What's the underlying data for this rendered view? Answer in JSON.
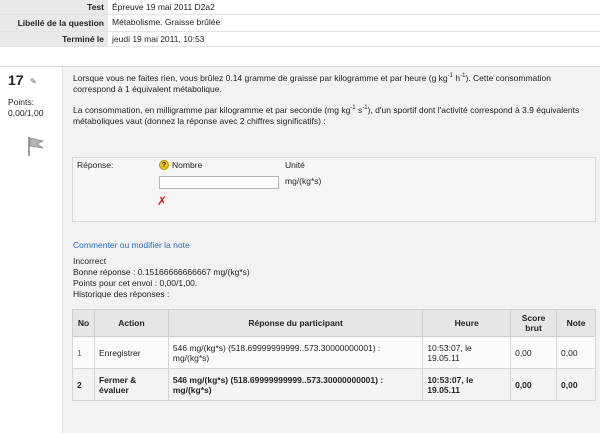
{
  "summary": {
    "rows": [
      {
        "label": "Test",
        "value": "Épreuve 19 mai 2011 D2a2"
      },
      {
        "label": "Libellé de la question",
        "value": "Métabolisme. Graisse brûlée"
      },
      {
        "label": "Terminé le",
        "value": "jeudi 19 mai 2011, 10:53"
      }
    ]
  },
  "question": {
    "number": "17",
    "points_label": "Points:",
    "points_value": "0,00/1,00",
    "text_p1": "Lorsque vous ne faites rien, vous brûlez 0.14 gramme de graisse par kilogramme et par heure (g kg",
    "text_p1_sup1": "-1",
    "text_p1_mid": " h",
    "text_p1_sup2": "-1",
    "text_p1_end": "). Cette consommation correspond à 1 équivalent métabolique.",
    "text_p2": "La consommation, en milligramme par kilogramme et par seconde (mg kg",
    "text_p2_sup1": "-1",
    "text_p2_mid": " s",
    "text_p2_sup2": "-1",
    "text_p2_end": "), d'un sportif dont l'activité correspond à 3.9 équivalents métaboliques vaut (donnez la réponse avec 2 chiffres significatifs) :"
  },
  "answer": {
    "label": "Réponse:",
    "help_symbol": "?",
    "number_label": "Nombre",
    "unit_label": "Unité",
    "input_value": "",
    "unit_value": "mg/(kg*s)",
    "wrong_symbol": "✗"
  },
  "feedback": {
    "comment_link": "Commenter ou modifier la note",
    "status": "Incorrect",
    "correct_answer": "Bonne réponse : 0.15166666666667 mg/(kg*s)",
    "points": "Points pour cet envoi : 0,00/1,00.",
    "history_title": "Historique des réponses :"
  },
  "history": {
    "headers": [
      "No",
      "Action",
      "Réponse du participant",
      "Heure",
      "Score brut",
      "Note"
    ],
    "rows": [
      {
        "no": "1",
        "action": "Enregistrer",
        "response": "546 mg/(kg*s) (518.69999999999..573.30000000001) : mg/(kg*s)",
        "time": "10:53:07, le 19.05.11",
        "score": "0,00",
        "grade": "0,00"
      },
      {
        "no": "2",
        "action": "Fermer & évaluer",
        "response": "546 mg/(kg*s) (518.69999999999..573.30000000001) : mg/(kg*s)",
        "time": "10:53:07, le 19.05.11",
        "score": "0,00",
        "grade": "0,00"
      }
    ]
  }
}
